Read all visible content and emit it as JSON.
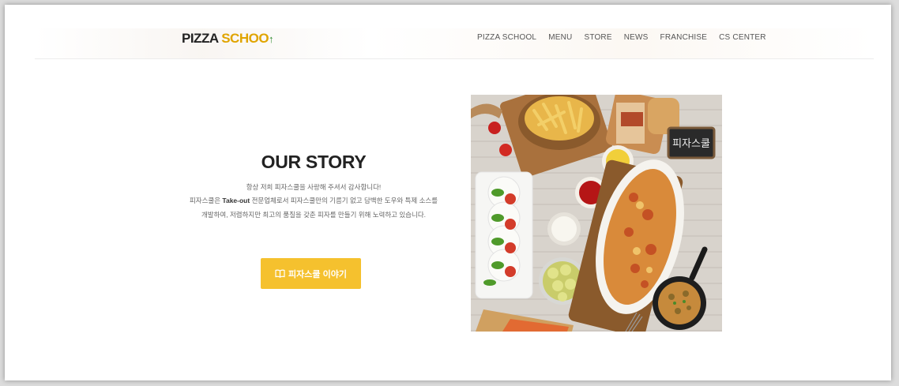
{
  "header": {
    "logo": {
      "part1": "PIZZA ",
      "part2": "SCHOO",
      "part3": "↑"
    },
    "nav": [
      "PIZZA SCHOOL",
      "MENU",
      "STORE",
      "NEWS",
      "FRANCHISE",
      "CS CENTER"
    ]
  },
  "story": {
    "title": "OUR STORY",
    "line1": "항상 저희 피자스쿨을 사랑해 주셔서 감사합니다!",
    "line2_pre": "피자스쿨은 ",
    "line2_bold": "Take-out",
    "line2_post": " 전문업체로서 피자스쿨만의 기름기 없고 담백한 도우와 특제 소스를 개발하여, 저렴하지만 최고의 품질을 갖춘 피자를 만들기 위해 노력하고 있습니다.",
    "button_label": "피자스쿨 이야기",
    "button_icon": "book-icon"
  },
  "photo": {
    "sign_text": "피자스쿨"
  },
  "colors": {
    "accent": "#f5c12e",
    "title": "#222222",
    "body_text": "#666666"
  }
}
